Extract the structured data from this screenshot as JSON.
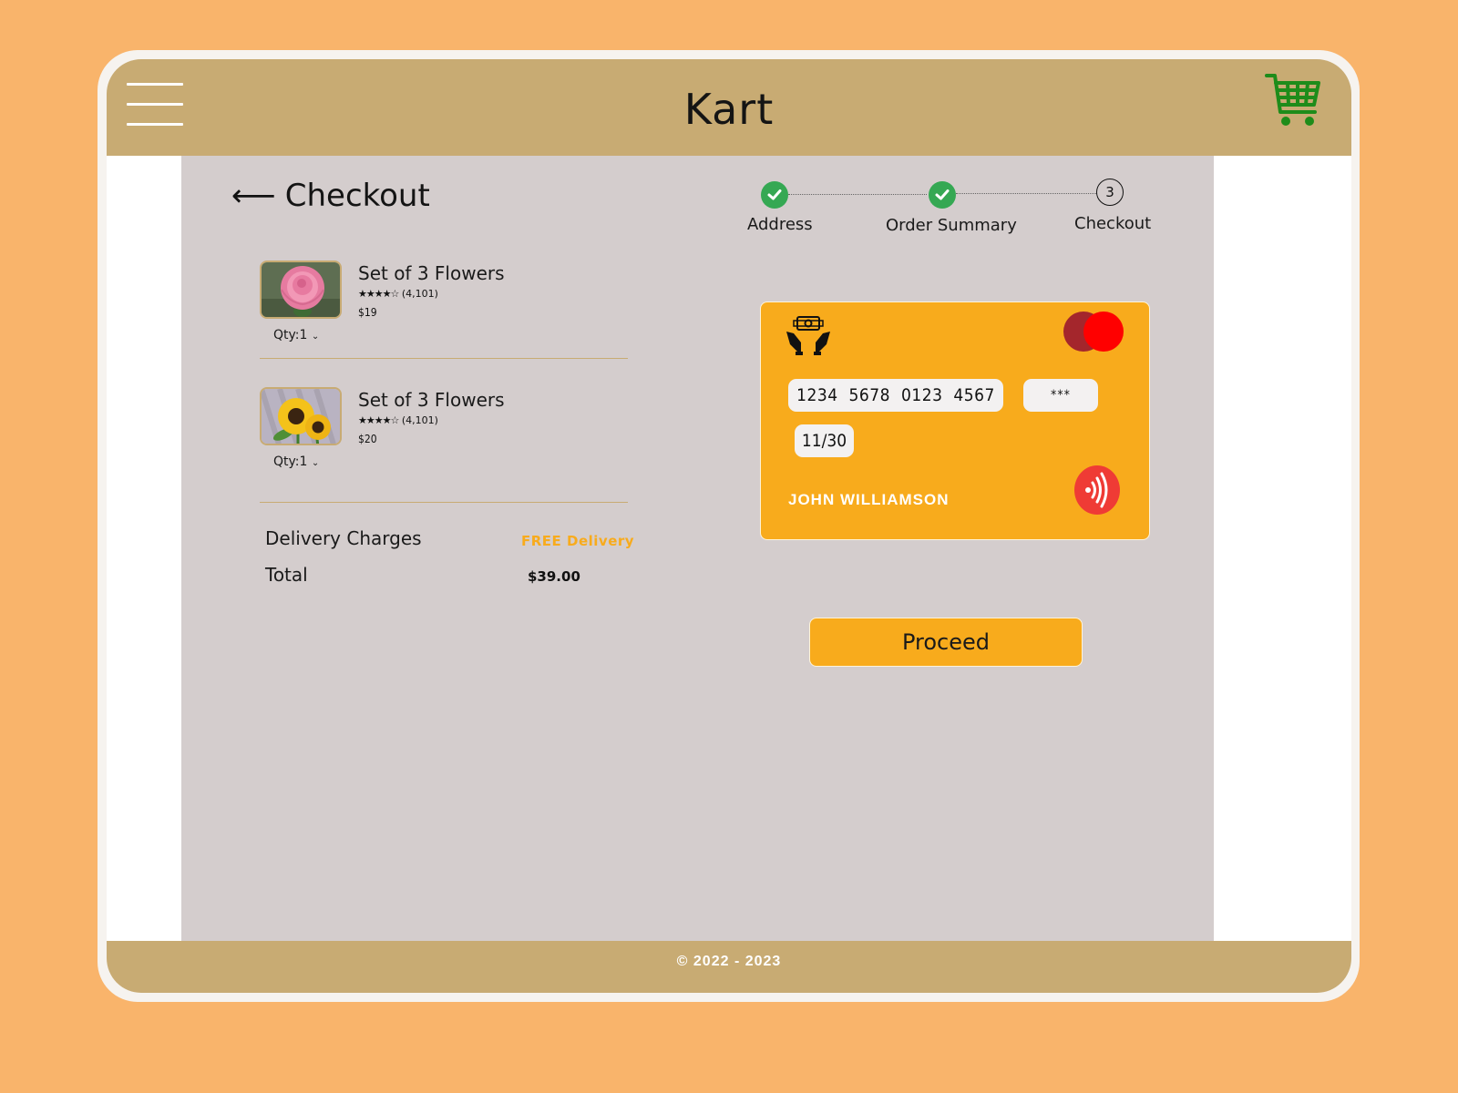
{
  "header": {
    "app_title": "Kart",
    "menu_icon": "hamburger-menu-icon",
    "cart_icon": "shopping-cart-icon",
    "cart_icon_color": "#1e8c1a"
  },
  "page": {
    "back_icon": "left-arrow-icon",
    "title": "Checkout"
  },
  "stepper": {
    "steps": [
      {
        "label": "Address",
        "status": "completed"
      },
      {
        "label": "Order Summary",
        "status": "completed"
      },
      {
        "label": "Checkout",
        "status": "current",
        "number": "3"
      }
    ],
    "completed_color": "#35a853"
  },
  "cart": {
    "items": [
      {
        "name": "Set of 3 Flowers",
        "stars": "★★★★☆",
        "rating_count": "(4,101)",
        "price": "$19",
        "qty": "Qty:1",
        "image": "pink-rose-image"
      },
      {
        "name": "Set of 3 Flowers",
        "stars": "★★★★☆",
        "rating_count": "(4,101)",
        "price": "$20",
        "qty": "Qty:1",
        "image": "sunflowers-image"
      }
    ]
  },
  "summary": {
    "delivery_label": "Delivery Charges",
    "delivery_value": "FREE Delivery",
    "total_label": "Total",
    "total_value": "$39.00"
  },
  "card": {
    "number": "1234 5678 0123 4567",
    "cvv": "***",
    "expiry": "11/30",
    "holder": "JOHN WILLIAMSON",
    "background_color": "#f8ab1c",
    "brand_icon": "mastercard-logo-icon",
    "payment_icon": "hands-money-icon",
    "contactless_icon": "contactless-icon"
  },
  "actions": {
    "proceed_label": "Proceed"
  },
  "footer": {
    "copyright": "© 2022 - 2023"
  }
}
